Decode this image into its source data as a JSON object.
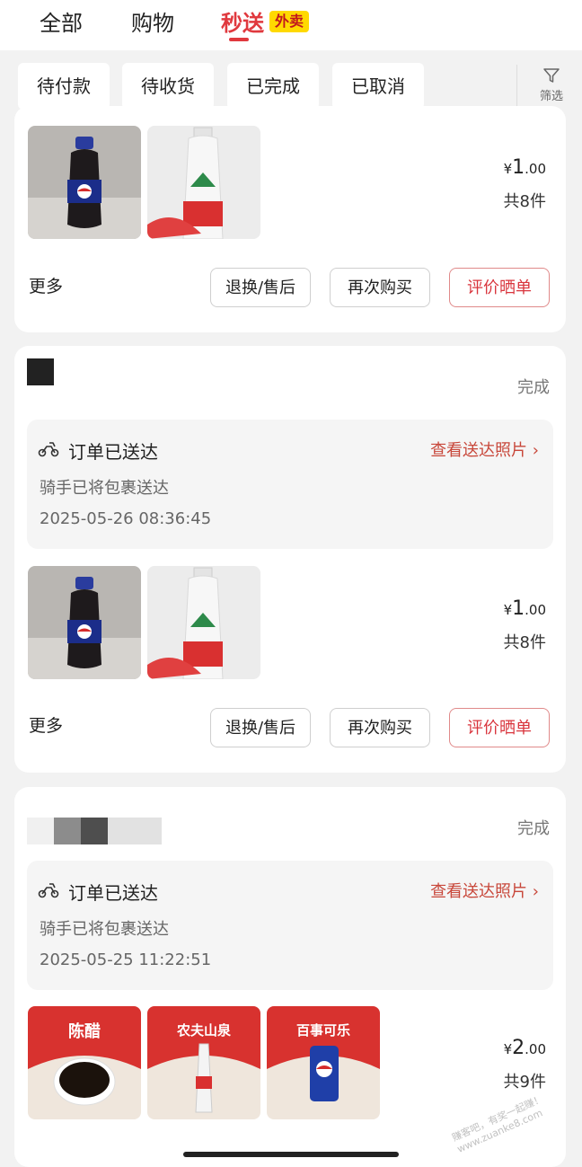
{
  "tabs": [
    {
      "label": "全部"
    },
    {
      "label": "购物"
    },
    {
      "label": "秒送",
      "badge": "外卖",
      "active": true
    }
  ],
  "filters": [
    "待付款",
    "待收货",
    "已完成",
    "已取消"
  ],
  "filter_button": {
    "label": "筛选",
    "icon": "funnel-icon"
  },
  "colors": {
    "accent": "#e0393e",
    "link": "#c8473a",
    "badge_bg": "#ffd900"
  },
  "orders": [
    {
      "price_currency": "¥",
      "price_int": "1",
      "price_dec": ".00",
      "count": "共8件",
      "items": [
        "pepsi-bottle-image",
        "nongfu-spring-bottle-image"
      ],
      "more": "更多",
      "actions": [
        "退换/售后",
        "再次购买",
        "评价晒单"
      ]
    },
    {
      "status": "完成",
      "delivery": {
        "title": "订单已送达",
        "link": "查看送达照片",
        "sub": "骑手已将包裹送达",
        "time": "2025-05-26 08:36:45"
      },
      "price_currency": "¥",
      "price_int": "1",
      "price_dec": ".00",
      "count": "共8件",
      "items": [
        "pepsi-bottle-image",
        "nongfu-spring-bottle-image"
      ],
      "more": "更多",
      "actions": [
        "退换/售后",
        "再次购买",
        "评价晒单"
      ]
    },
    {
      "status": "完成",
      "delivery": {
        "title": "订单已送达",
        "link": "查看送达照片",
        "sub": "骑手已将包裹送达",
        "time": "2025-05-25 11:22:51"
      },
      "price_currency": "¥",
      "price_int": "2",
      "price_dec": ".00",
      "count": "共9件",
      "items": [
        {
          "icon": "vinegar-product-image",
          "label": "陈醋"
        },
        {
          "icon": "nongfu-spring-product-image",
          "label": "农夫山泉"
        },
        {
          "icon": "pepsi-can-product-image",
          "label": "百事可乐"
        }
      ]
    }
  ],
  "watermark": "赚客吧，有奖一起赚！ www.zuanke8.com"
}
